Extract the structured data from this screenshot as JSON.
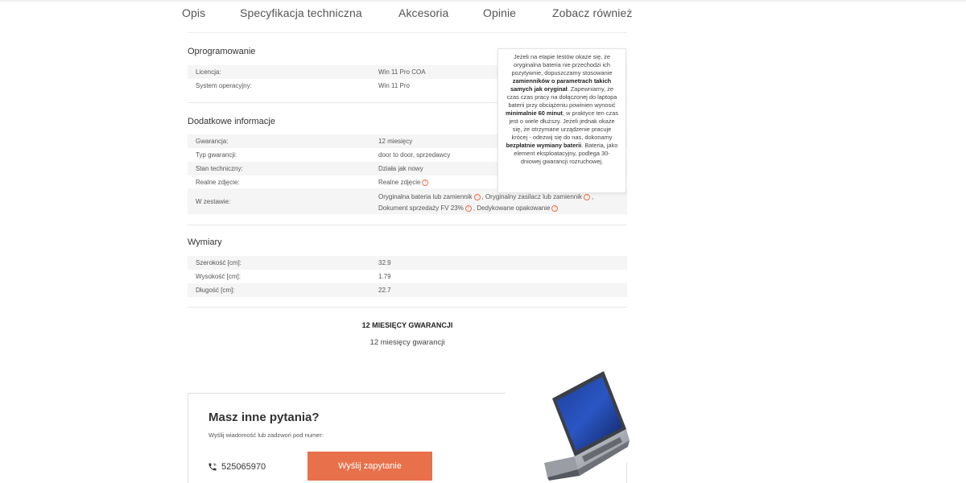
{
  "tabs": [
    "Opis",
    "Specyfikacja techniczna",
    "Akcesoria",
    "Opinie",
    "Zobacz również"
  ],
  "software": {
    "title": "Oprogramowanie",
    "rows": [
      {
        "key": "Licencja:",
        "value": "Win 11 Pro COA"
      },
      {
        "key": "System operacyjny:",
        "value": "Win 11 Pro"
      }
    ]
  },
  "additional": {
    "title": "Dodatkowe informacje",
    "rows": [
      {
        "key": "Gwarancja:",
        "value": "12 miesięcy"
      },
      {
        "key": "Typ gwarancji:",
        "value": "door to door, sprzedawcy"
      },
      {
        "key": "Stan techniczny:",
        "value": "Działa jak nowy"
      },
      {
        "key": "Realne zdjęcie:",
        "value": "Realne zdjęcie"
      }
    ],
    "set": {
      "key": "W zestawie:",
      "item1": "Oryginalna bateria lub zamiennik",
      "item2": ", Oryginalny zasilacz lub zamiennik",
      "item3": "Dokument sprzedaży FV 23%",
      "item4": ", Dedykowane opakowanie",
      "comma": ","
    }
  },
  "dimensions": {
    "title": "Wymiary",
    "rows": [
      {
        "key": "Szerokość [cm]:",
        "value": "32.9"
      },
      {
        "key": "Wysokość [cm]:",
        "value": "1.79"
      },
      {
        "key": "Długość [cm]:",
        "value": "22.7"
      }
    ]
  },
  "tooltip": {
    "p1": "Jeżeli na etapie testów okaże się, że oryginalna bateria nie przechodzi ich pozytywnie, dopuszczamy stosowanie ",
    "b1": "zamienników o parametrach takich samych jak oryginał",
    "p2": ". Zapewniamy, że czas czas pracy na dołączonej do laptopa baterii przy obciążeniu powinien wynosić ",
    "b2": "minimalnie 60 minut",
    "p3": ", w praktyce ten czas jest o wiele dłuższy. Jeżeli jednak okaże się, że otrzymane urządzenie pracuje krócej - odezwij się do nas, dokonamy ",
    "b3": "bezpłatnie wymiany baterii",
    "p4": ". Bateria, jako element eksploatacyjny, podlega 30-dniowej gwarancji rozruchowej."
  },
  "warranty": {
    "heading": "12 MIESIĘCY GWARANCJI",
    "text": "12 miesięcy gwarancji"
  },
  "contact": {
    "title": "Masz inne pytania?",
    "subtitle": "Wyślij wiadomość lub zadzwoń pod numer:",
    "phone": "525065970",
    "button": "Wyślij zapytanie"
  },
  "colors": {
    "accent": "#e8704a",
    "row_shade": "#f5f5f5"
  }
}
